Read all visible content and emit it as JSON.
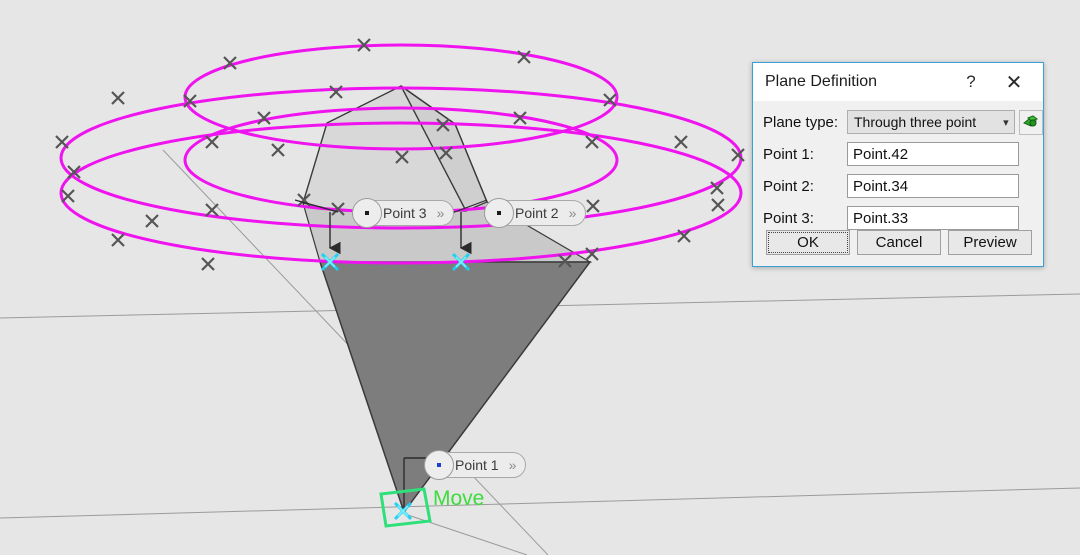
{
  "viewport": {
    "background_color": "#e6e6e6",
    "geometry_colors": {
      "ellipse_magenta": "#ef13ef",
      "marker_gray": "#555555",
      "marker_cyan": "#17d2f5",
      "cone_upper_fill": "#d6d6d6",
      "cone_lower_fill": "#7a7a7a",
      "edge_stroke": "#3a3a3a",
      "grid_line": "#9b9b9b",
      "move_green": "#3ddc3d"
    },
    "labels": [
      {
        "name": "Point 3",
        "chevron": "»"
      },
      {
        "name": "Point 2",
        "chevron": "»"
      },
      {
        "name": "Point 1",
        "chevron": "»"
      }
    ],
    "move_label": "Move"
  },
  "dialog": {
    "title": "Plane Definition",
    "help_glyph": "?",
    "close_glyph": "✕",
    "border_color": "#3a9fd6",
    "plane_type": {
      "label": "Plane type:",
      "value": "Through three point",
      "caret": "⌄",
      "options": [
        "Through three point"
      ],
      "picker_icon": "plane-picker-icon"
    },
    "points": [
      {
        "label": "Point 1:",
        "value": "Point.42"
      },
      {
        "label": "Point 2:",
        "value": "Point.34"
      },
      {
        "label": "Point 3:",
        "value": "Point.33"
      }
    ],
    "buttons": [
      {
        "label": "OK",
        "focused": true
      },
      {
        "label": "Cancel",
        "focused": false
      },
      {
        "label": "Preview",
        "focused": false
      }
    ]
  }
}
